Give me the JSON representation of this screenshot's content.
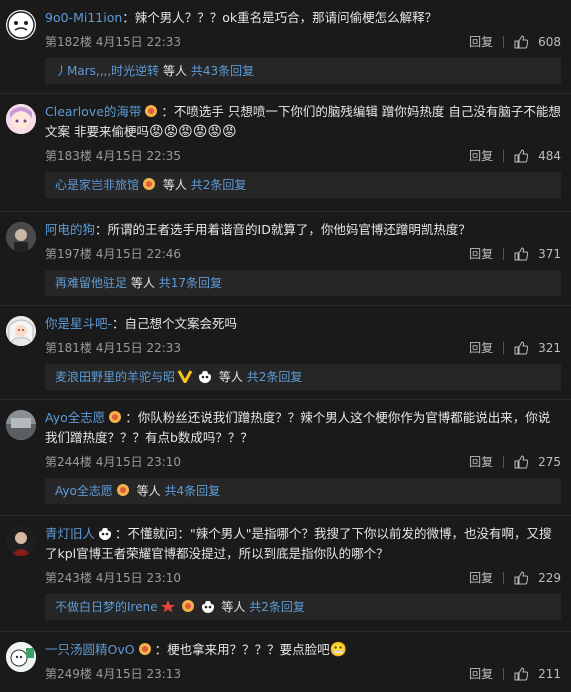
{
  "comments": [
    {
      "user": "9o0-Mi11ion",
      "text": "：辣个男人？？？ok重名是巧合，那请问偷梗怎么解释？",
      "floor": "第182楼",
      "time": "4月15日 22:33",
      "reply_label": "回复",
      "likes": "608",
      "reply_user": "丿Mars,,,,时光逆转",
      "reply_mid": "等人",
      "reply_more": "共43条回复"
    },
    {
      "user": "Clearlove的海带",
      "text": "：不喷选手 只想喷一下你们的脑残编辑 蹭你妈热度 自己没有脑子不能想文案 非要来偷梗吗",
      "floor": "第183楼",
      "time": "4月15日 22:35",
      "reply_label": "回复",
      "likes": "484",
      "reply_user": "心是家岂非旅馆",
      "reply_mid": "等人",
      "reply_more": "共2条回复"
    },
    {
      "user": "阿电的狗",
      "text": "：所谓的王者选手用着谐音的ID就算了，你他妈官博还蹭明凯热度？",
      "floor": "第197楼",
      "time": "4月15日 22:46",
      "reply_label": "回复",
      "likes": "371",
      "reply_user": "再难留他驻足",
      "reply_mid": "等人",
      "reply_more": "共17条回复"
    },
    {
      "user": "你是星斗吧-",
      "text": "：自己想个文案会死吗",
      "floor": "第181楼",
      "time": "4月15日 22:33",
      "reply_label": "回复",
      "likes": "321",
      "reply_user": "麦浪田野里的羊驼与昭",
      "reply_mid": "等人",
      "reply_more": "共2条回复"
    },
    {
      "user": "Ayo全志愿",
      "text": "：你队粉丝还说我们蹭热度？？辣个男人这个梗你作为官博都能说出来，你说我们蹭热度？？？有点b数成吗？？？",
      "floor": "第244楼",
      "time": "4月15日 23:10",
      "reply_label": "回复",
      "likes": "275",
      "reply_user": "Ayo全志愿",
      "reply_mid": "等人",
      "reply_more": "共4条回复"
    },
    {
      "user": "青灯旧人",
      "text": "：不懂就问：\"辣个男人\"是指哪个？我搜了下你以前发的微博，也没有啊，又搜了kpl官博王者荣耀官博都没提过，所以到底是指你队的哪个？",
      "floor": "第243楼",
      "time": "4月15日 23:10",
      "reply_label": "回复",
      "likes": "229",
      "reply_user": "不做白日梦的Irene",
      "reply_mid": "等人",
      "reply_more": "共2条回复"
    },
    {
      "user": "一只汤圆精OvO",
      "text": "：梗也拿来用？？？？要点脸吧",
      "floor": "第249楼",
      "time": "4月15日 23:13",
      "reply_label": "回复",
      "likes": "211"
    }
  ]
}
